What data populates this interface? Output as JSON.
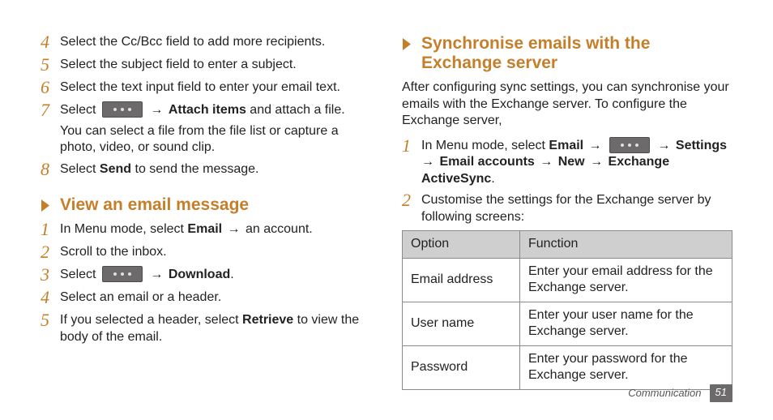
{
  "left": {
    "steps_top": [
      {
        "n": "4",
        "text_plain": "Select the Cc/Bcc field to add more recipients."
      },
      {
        "n": "5",
        "text_plain": "Select the subject field to enter a subject."
      },
      {
        "n": "6",
        "text_plain": "Select the text input field to enter your email text."
      }
    ],
    "step7": {
      "n": "7",
      "pre": "Select ",
      "arrow": " → ",
      "bold_after": "Attach items",
      "post": " and attach a file.",
      "sub": "You can select a file from the file list or capture a photo, video, or sound clip."
    },
    "step8": {
      "n": "8",
      "pre": "Select ",
      "bold": "Send",
      "post": " to send the message."
    },
    "heading_view": "View an email message",
    "view_steps": {
      "s1": {
        "n": "1",
        "pre": "In Menu mode, select ",
        "bold": "Email",
        "arrow": " → ",
        "post": "an account."
      },
      "s2": {
        "n": "2",
        "text_plain": "Scroll to the inbox."
      },
      "s3": {
        "n": "3",
        "pre": "Select ",
        "arrow": " → ",
        "bold_after": "Download",
        "post": "."
      },
      "s4": {
        "n": "4",
        "text_plain": "Select an email or a header."
      },
      "s5": {
        "n": "5",
        "pre": "If you selected a header, select ",
        "bold": "Retrieve",
        "post": " to view the body of the email."
      }
    }
  },
  "right": {
    "heading_sync": "Synchronise emails with the Exchange server",
    "intro": "After configuring sync settings, you can synchronise your emails with the Exchange server. To configure the Exchange server,",
    "step1": {
      "n": "1",
      "pre": "In Menu mode, select ",
      "b1": "Email",
      "arrow1": " → ",
      "arrow2": " → ",
      "b2": "Settings",
      "arrow3": " → ",
      "line2_b1": "Email accounts",
      "line2_a1": " → ",
      "line2_b2": "New",
      "line2_a2": " → ",
      "line2_b3": "Exchange ActiveSync",
      "line2_post": "."
    },
    "step2": {
      "n": "2",
      "text_plain": "Customise the settings for the Exchange server by following screens:"
    },
    "table": {
      "head_option": "Option",
      "head_function": "Function",
      "rows": [
        {
          "opt": "Email address",
          "fn": "Enter your email address for the Exchange server."
        },
        {
          "opt": "User name",
          "fn": "Enter your user name for the Exchange server."
        },
        {
          "opt": "Password",
          "fn": "Enter your password for the Exchange server."
        }
      ]
    }
  },
  "footer": {
    "section": "Communication",
    "page": "51"
  }
}
